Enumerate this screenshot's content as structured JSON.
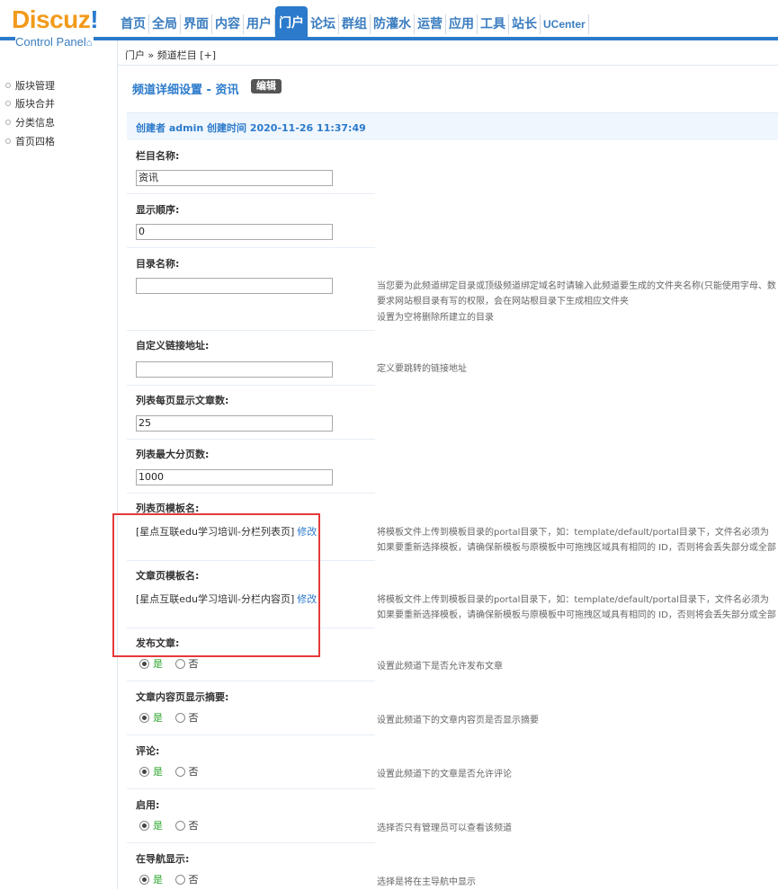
{
  "header": {
    "logo_main": "Discuz",
    "logo_bang": "!",
    "logo_sub": "Control Panel",
    "nav": [
      "首页",
      "全局",
      "界面",
      "内容",
      "用户",
      "门户",
      "论坛",
      "群组",
      "防灌水",
      "运营",
      "应用",
      "工具",
      "站长",
      "UCenter"
    ],
    "active_nav": "门户"
  },
  "sidebar": {
    "items": [
      "版块管理",
      "版块合并",
      "分类信息",
      "首页四格"
    ]
  },
  "breadcrumb": "门户 » 频道栏目 [+]",
  "page": {
    "title": "频道详细设置 - 资讯",
    "edit_badge": "编辑",
    "info": "创建者 admin 创建时间 2020-11-26 11:37:49"
  },
  "form": {
    "catname_label": "栏目名称:",
    "catname_value": "资讯",
    "order_label": "显示顺序:",
    "order_value": "0",
    "dir_label": "目录名称:",
    "dir_value": "",
    "dir_hint": [
      "当您要为此频道绑定目录或顶级频道绑定域名时请输入此频道要生成的文件夹名称(只能使用字母、数",
      "要求网站根目录有写的权限，会在网站根目录下生成相应文件夹",
      "设置为空将删除所建立的目录"
    ],
    "url_label": "自定义链接地址:",
    "url_value": "",
    "url_hint": "定义要跳转的链接地址",
    "perpage_label": "列表每页显示文章数:",
    "perpage_value": "25",
    "maxpages_label": "列表最大分页数:",
    "maxpages_value": "1000",
    "list_tpl_label": "列表页模板名:",
    "list_tpl_value": "[星点互联edu学习培训-分栏列表页]",
    "article_tpl_label": "文章页模板名:",
    "article_tpl_value": "[星点互联edu学习培训-分栏内容页]",
    "modify": "修改",
    "tpl_hint": [
      "将模板文件上传到模板目录的portal目录下，如：template/default/portal目录下，文件名必须为",
      "如果要重新选择模板，请确保新模板与原模板中可拖拽区域具有相同的 ID，否则将会丢失部分或全部"
    ],
    "publish_label": "发布文章:",
    "publish_hint": "设置此频道下是否允许发布文章",
    "summary_label": "文章内容页显示摘要:",
    "summary_hint": "设置此频道下的文章内容页是否显示摘要",
    "comment_label": "评论:",
    "comment_hint": "设置此频道下的文章是否允许评论",
    "enable_label": "启用:",
    "enable_hint": "选择否只有管理员可以查看该频道",
    "shownav_label": "在导航显示:",
    "shownav_hint": "选择是将在主导航中显示",
    "yes": "是",
    "no": "否"
  },
  "colors": {
    "accent": "#2b7acb",
    "logo": "#f29a1b",
    "highlight": "#e53a3a",
    "yes": "#2aa52a"
  }
}
